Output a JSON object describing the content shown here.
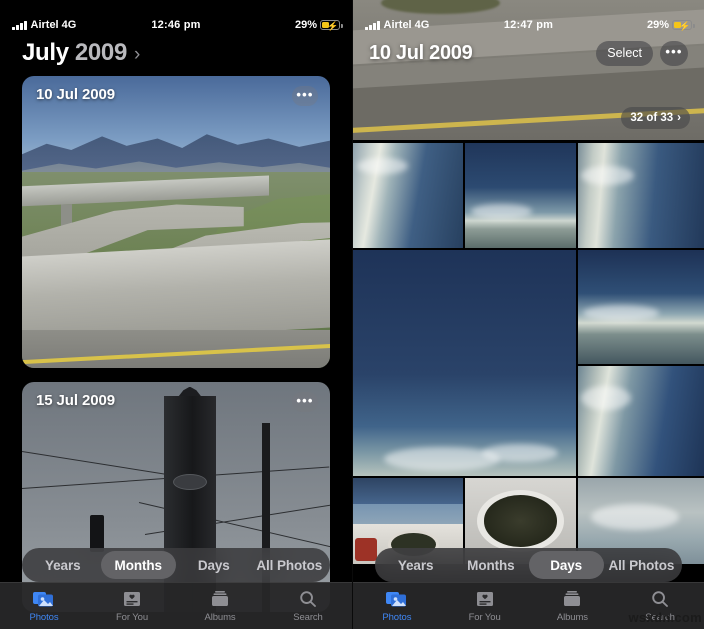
{
  "left": {
    "status": {
      "carrier": "Airtel 4G",
      "time": "12:46 pm",
      "battery": "29%"
    },
    "header": {
      "month": "July",
      "year": "2009",
      "chevron": "›"
    },
    "cards": [
      {
        "label": "10 Jul 2009",
        "more": "•••"
      },
      {
        "label": "15 Jul 2009",
        "more": "•••"
      }
    ],
    "segmented": {
      "options": [
        "Years",
        "Months",
        "Days",
        "All Photos"
      ],
      "selected": "Months"
    },
    "tabs": [
      {
        "label": "Photos",
        "icon": "photos-icon",
        "active": true
      },
      {
        "label": "For You",
        "icon": "for-you-icon",
        "active": false
      },
      {
        "label": "Albums",
        "icon": "albums-icon",
        "active": false
      },
      {
        "label": "Search",
        "icon": "search-icon",
        "active": false
      }
    ]
  },
  "right": {
    "status": {
      "carrier": "Airtel 4G",
      "time": "12:47 pm",
      "battery": "29%"
    },
    "header": {
      "title": "10 Jul 2009",
      "select": "Select",
      "more": "•••"
    },
    "count_badge": {
      "text": "32 of 33",
      "chevron": "›"
    },
    "segmented": {
      "options": [
        "Years",
        "Months",
        "Days",
        "All Photos"
      ],
      "selected": "Days"
    },
    "tabs": [
      {
        "label": "Photos",
        "icon": "photos-icon",
        "active": true
      },
      {
        "label": "For You",
        "icon": "for-you-icon",
        "active": false
      },
      {
        "label": "Albums",
        "icon": "albums-icon",
        "active": false
      },
      {
        "label": "Search",
        "icon": "search-icon",
        "active": false
      }
    ]
  },
  "watermark": "wsxdn.com",
  "colors": {
    "accent": "#3f87f5",
    "battery": "#f5c518",
    "segment_selected": "#636366"
  }
}
